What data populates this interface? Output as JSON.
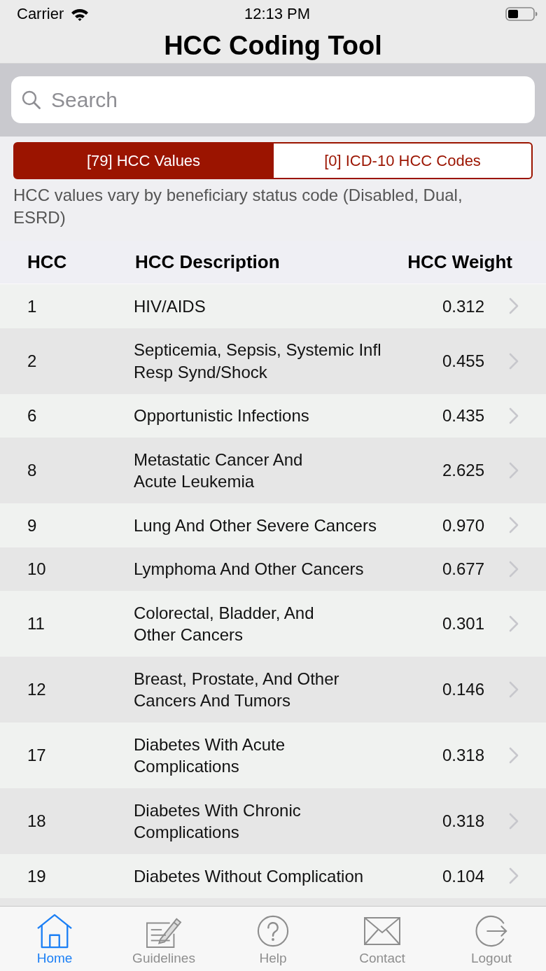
{
  "status_bar": {
    "carrier": "Carrier",
    "time": "12:13 PM"
  },
  "navigation_bar": {
    "title": "HCC Coding Tool"
  },
  "search": {
    "placeholder": "Search"
  },
  "segments": [
    {
      "label": "[79] HCC Values",
      "selected": true
    },
    {
      "label": "[0] ICD-10 HCC Codes",
      "selected": false
    }
  ],
  "note": "HCC values vary by beneficiary status code (Disabled, Dual, ESRD)",
  "table": {
    "columns": [
      "HCC",
      "HCC Description",
      "HCC Weight"
    ],
    "rows": [
      {
        "hcc": "1",
        "description": "HIV/AIDS",
        "weight": "0.312"
      },
      {
        "hcc": "2",
        "description": "Septicemia, Sepsis, Systemic Infl\nResp Synd/Shock",
        "weight": "0.455"
      },
      {
        "hcc": "6",
        "description": "Opportunistic Infections",
        "weight": "0.435"
      },
      {
        "hcc": "8",
        "description": "Metastatic Cancer And\nAcute Leukemia",
        "weight": "2.625"
      },
      {
        "hcc": "9",
        "description": "Lung And Other Severe Cancers",
        "weight": "0.970"
      },
      {
        "hcc": "10",
        "description": "Lymphoma And Other Cancers",
        "weight": "0.677"
      },
      {
        "hcc": "11",
        "description": "Colorectal, Bladder, And\nOther Cancers",
        "weight": "0.301"
      },
      {
        "hcc": "12",
        "description": "Breast, Prostate, And Other\nCancers And Tumors",
        "weight": "0.146"
      },
      {
        "hcc": "17",
        "description": "Diabetes With Acute\nComplications",
        "weight": "0.318"
      },
      {
        "hcc": "18",
        "description": "Diabetes With Chronic\nComplications",
        "weight": "0.318"
      },
      {
        "hcc": "19",
        "description": "Diabetes Without Complication",
        "weight": "0.104"
      }
    ]
  },
  "tab_bar": [
    {
      "label": "Home",
      "selected": true
    },
    {
      "label": "Guidelines",
      "selected": false
    },
    {
      "label": "Help",
      "selected": false
    },
    {
      "label": "Contact",
      "selected": false
    },
    {
      "label": "Logout",
      "selected": false
    }
  ]
}
